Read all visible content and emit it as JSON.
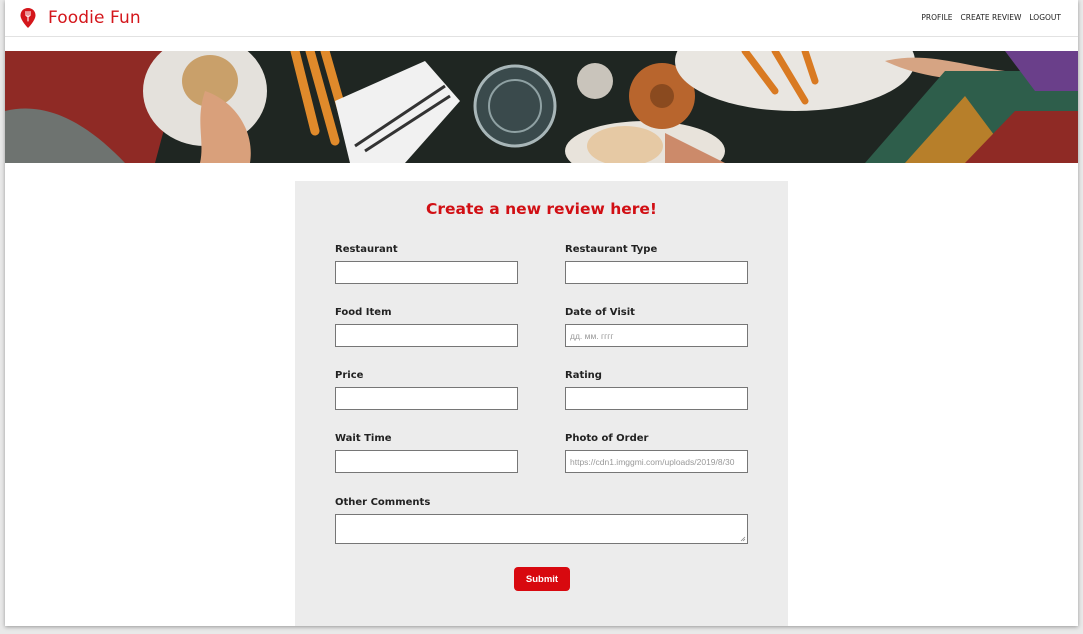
{
  "header": {
    "brand": "Foodie Fun",
    "nav": [
      "PROFILE",
      "CREATE REVIEW",
      "LOGOUT"
    ]
  },
  "hero": {
    "icon": "food-table-banner"
  },
  "form": {
    "title": "Create a new review here!",
    "fields": {
      "restaurant": {
        "label": "Restaurant",
        "value": ""
      },
      "restaurant_type": {
        "label": "Restaurant Type",
        "value": ""
      },
      "food_item": {
        "label": "Food Item",
        "value": ""
      },
      "date_of_visit": {
        "label": "Date of Visit",
        "placeholder": "дд. мм. гггг"
      },
      "price": {
        "label": "Price",
        "value": ""
      },
      "rating": {
        "label": "Rating",
        "value": ""
      },
      "wait_time": {
        "label": "Wait Time",
        "value": ""
      },
      "photo_of_order": {
        "label": "Photo of Order",
        "placeholder": "https://cdn1.imggmi.com/uploads/2019/8/30"
      },
      "other_comments": {
        "label": "Other Comments",
        "value": ""
      }
    },
    "submit_label": "Submit"
  },
  "colors": {
    "brand": "#d4161b",
    "card_bg": "#ececec",
    "button": "#d8090f"
  }
}
